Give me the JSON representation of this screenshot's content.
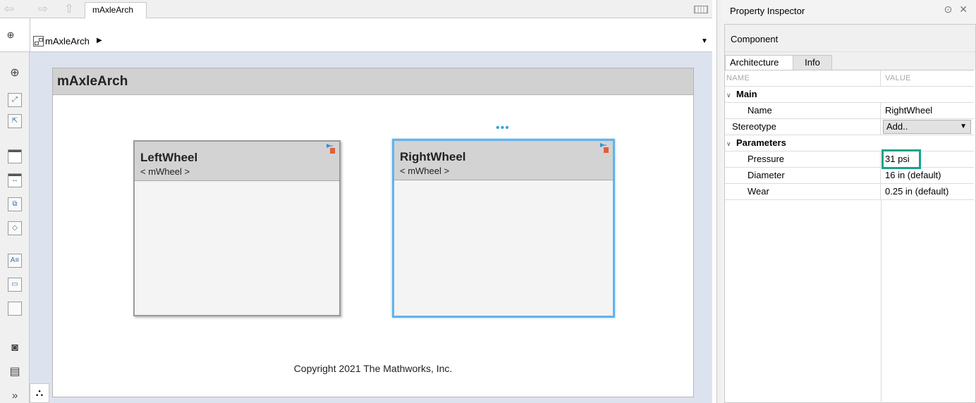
{
  "toolbar": {
    "back_icon": "back-arrow-icon",
    "forward_icon": "forward-arrow-icon",
    "up_icon": "up-arrow-icon",
    "tab_label": "mAxleArch"
  },
  "address": {
    "model_name": "mAxleArch",
    "path_arrow": "▶",
    "dropdown_arrow": "▼"
  },
  "canvas": {
    "title": "mAxleArch",
    "components": [
      {
        "name": "LeftWheel",
        "stereotype": "< mWheel >",
        "selected": false
      },
      {
        "name": "RightWheel",
        "stereotype": "< mWheel >",
        "selected": true
      }
    ],
    "ellipsis": "•••",
    "copyright": "Copyright 2021 The Mathworks, Inc."
  },
  "inspector": {
    "title": "Property Inspector",
    "section": "Component",
    "tabs": [
      "Architecture",
      "Info"
    ],
    "columns": {
      "name": "NAME",
      "value": "VALUE"
    },
    "rows": {
      "main_group": "Main",
      "name_label": "Name",
      "name_value": "RightWheel",
      "stereotype_label": "Stereotype",
      "stereotype_value": "Add..",
      "parameters_group": "Parameters",
      "pressure_label": "Pressure",
      "pressure_value": "31 psi",
      "diameter_label": "Diameter",
      "diameter_value": "16 in (default)",
      "wear_label": "Wear",
      "wear_value": "0.25 in (default)"
    }
  },
  "colors": {
    "selection": "#62b3ea",
    "highlight": "#1ca289",
    "canvas_bg": "#dde3ee"
  }
}
